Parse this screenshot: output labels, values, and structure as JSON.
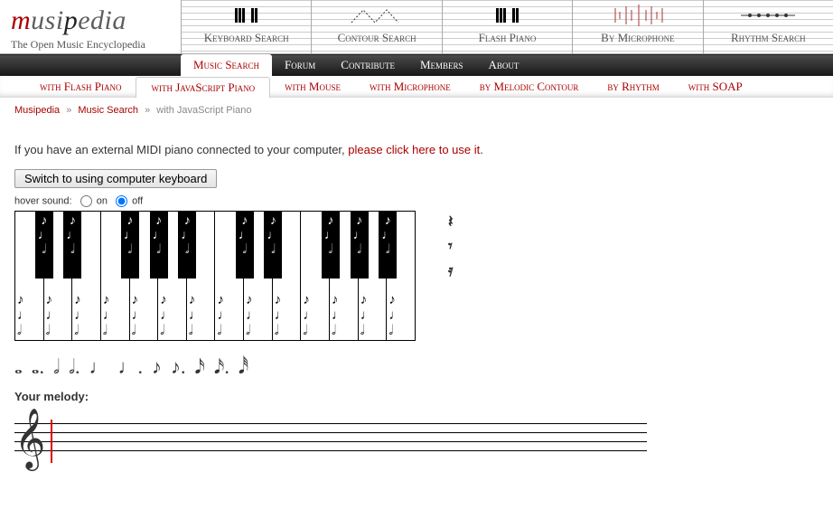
{
  "brand": {
    "prefix": "m",
    "mid": "usi",
    "p": "p",
    "suffix": "edia",
    "tagline": "The Open Music Encyclopedia"
  },
  "header_tabs": [
    "Keyboard Search",
    "Contour Search",
    "Flash Piano",
    "By Microphone",
    "Rhythm Search"
  ],
  "nav": [
    "Music Search",
    "Forum",
    "Contribute",
    "Members",
    "About"
  ],
  "sub_nav": [
    "with Flash Piano",
    "with JavaScript Piano",
    "with Mouse",
    "with Microphone",
    "by Melodic Contour",
    "by Rhythm",
    "with SOAP"
  ],
  "breadcrumb": {
    "root": "Musipedia",
    "sep": "»",
    "mid": "Music Search",
    "leaf": "with JavaScript Piano"
  },
  "intro": {
    "text": "If you have an external MIDI piano connected to your computer, ",
    "link": "please click here to use it",
    "tail": "."
  },
  "switch_button": "Switch to using computer keyboard",
  "hover": {
    "label": "hover sound:",
    "on": "on",
    "off": "off",
    "selected": "off"
  },
  "piano": {
    "white_count": 14,
    "black_positions": [
      0,
      1,
      3,
      4,
      5,
      7,
      8,
      10,
      11,
      12
    ]
  },
  "rests": [
    "𝄽",
    "𝄾",
    "𝄿"
  ],
  "durations": [
    "𝅝",
    "𝅝.",
    "𝅗𝅥",
    "𝅗𝅥.",
    "♩",
    "♩.",
    "♪",
    "♪.",
    "𝅘𝅥𝅯",
    "𝅘𝅥𝅯.",
    "𝅘𝅥𝅰"
  ],
  "melody_label": "Your melody:"
}
